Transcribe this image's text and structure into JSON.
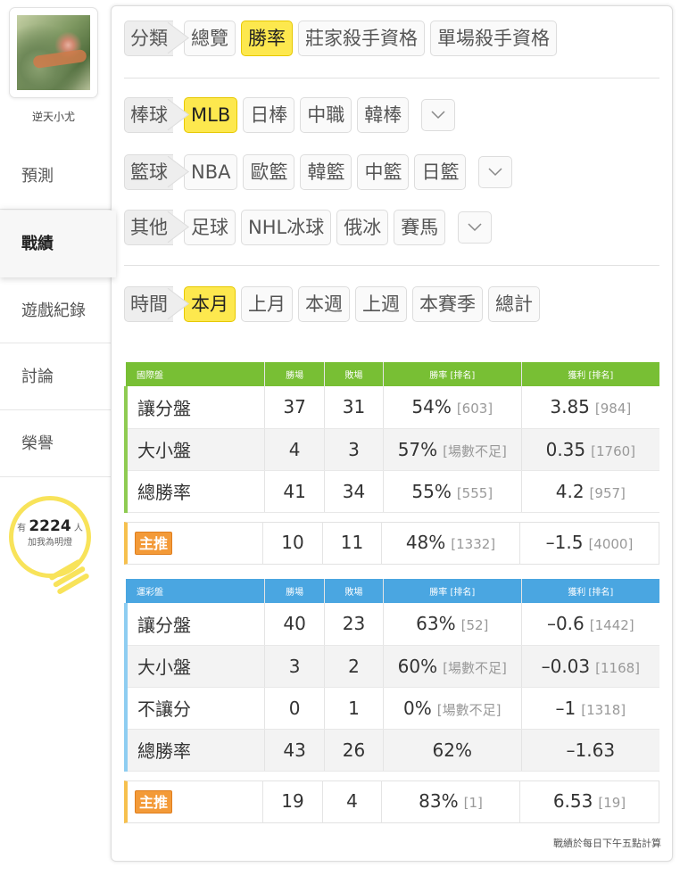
{
  "sidebar": {
    "username": "逆天小尤",
    "nav": [
      "預測",
      "戰績",
      "遊戲紀錄",
      "討論",
      "榮譽"
    ],
    "active_nav": "戰績",
    "fans": {
      "prefix": "有",
      "count": "2224",
      "suffix": "人",
      "caption": "加我為明燈"
    }
  },
  "filters": {
    "category": {
      "label": "分類",
      "options": [
        "總覽",
        "勝率",
        "莊家殺手資格",
        "單場殺手資格"
      ],
      "selected": "勝率"
    },
    "baseball": {
      "label": "棒球",
      "options": [
        "MLB",
        "日棒",
        "中職",
        "韓棒"
      ],
      "selected": "MLB"
    },
    "basketball": {
      "label": "籃球",
      "options": [
        "NBA",
        "歐籃",
        "韓籃",
        "中籃",
        "日籃"
      ],
      "selected": ""
    },
    "other": {
      "label": "其他",
      "options": [
        "足球",
        "NHL冰球",
        "俄冰",
        "賽馬"
      ],
      "selected": ""
    },
    "time": {
      "label": "時間",
      "options": [
        "本月",
        "上月",
        "本週",
        "上週",
        "本賽季",
        "總計"
      ],
      "selected": "本月"
    }
  },
  "international": {
    "headers": [
      "國際盤",
      "勝場",
      "敗場",
      "勝率 [排名]",
      "獲利 [排名]"
    ],
    "rows": [
      {
        "name": "讓分盤",
        "win": "37",
        "loss": "31",
        "rate": "54%",
        "rate_rank": "[603]",
        "profit": "3.85",
        "profit_rank": "[984]"
      },
      {
        "name": "大小盤",
        "win": "4",
        "loss": "3",
        "rate": "57%",
        "rate_rank": "[場數不足]",
        "profit": "0.35",
        "profit_rank": "[1760]"
      },
      {
        "name": "總勝率",
        "win": "41",
        "loss": "34",
        "rate": "55%",
        "rate_rank": "[555]",
        "profit": "4.2",
        "profit_rank": "[957]"
      }
    ],
    "pick": {
      "label": "主推",
      "win": "10",
      "loss": "11",
      "rate": "48%",
      "rate_rank": "[1332]",
      "profit": "–1.5",
      "profit_rank": "[4000]"
    }
  },
  "sportslottery": {
    "headers": [
      "運彩盤",
      "勝場",
      "敗場",
      "勝率 [排名]",
      "獲利 [排名]"
    ],
    "rows": [
      {
        "name": "讓分盤",
        "win": "40",
        "loss": "23",
        "rate": "63%",
        "rate_rank": "[52]",
        "profit": "–0.6",
        "profit_rank": "[1442]"
      },
      {
        "name": "大小盤",
        "win": "3",
        "loss": "2",
        "rate": "60%",
        "rate_rank": "[場數不足]",
        "profit": "–0.03",
        "profit_rank": "[1168]"
      },
      {
        "name": "不讓分",
        "win": "0",
        "loss": "1",
        "rate": "0%",
        "rate_rank": "[場數不足]",
        "profit": "–1",
        "profit_rank": "[1318]"
      },
      {
        "name": "總勝率",
        "win": "43",
        "loss": "26",
        "rate": "62%",
        "rate_rank": "",
        "profit": "–1.63",
        "profit_rank": ""
      }
    ],
    "pick": {
      "label": "主推",
      "win": "19",
      "loss": "4",
      "rate": "83%",
      "rate_rank": "[1]",
      "profit": "6.53",
      "profit_rank": "[19]"
    }
  },
  "footnote": "戰績於每日下午五點計算",
  "colors": {
    "selected": "#fde84e",
    "international_header": "#78bf34",
    "lottery_header": "#4aa6e1",
    "pick_badge": "#f39a38"
  }
}
